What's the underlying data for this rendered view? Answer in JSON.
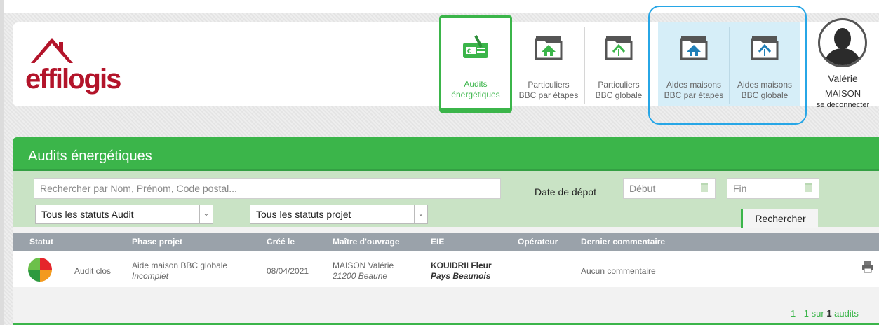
{
  "brand": {
    "name": "effilogis",
    "accent": "#3bb54a",
    "highlight": "#27a6e6"
  },
  "nav": {
    "items": [
      {
        "line1": "Audits",
        "line2": "énergétiques",
        "icon": "energy-audit-icon",
        "active": true
      },
      {
        "line1": "Particuliers",
        "line2": "BBC par étapes",
        "icon": "folder-house-icon"
      },
      {
        "line1": "Particuliers",
        "line2": "BBC globale",
        "icon": "folder-house-icon"
      },
      {
        "line1": "Aides maisons",
        "line2": "BBC par étapes",
        "icon": "folder-house-icon"
      },
      {
        "line1": "Aides maisons",
        "line2": "BBC globale",
        "icon": "folder-house-icon"
      }
    ]
  },
  "user": {
    "first": "Valérie",
    "last": "MAISON",
    "logout": "se déconnecter",
    "avatar_icon": "user-silhouette-icon"
  },
  "panel": {
    "title": "Audits énergétiques"
  },
  "filters": {
    "search_placeholder": "Rechercher par Nom, Prénom, Code postal...",
    "date_label": "Date de dépot",
    "start_placeholder": "Début",
    "end_placeholder": "Fin",
    "status_audit": "Tous les statuts Audit",
    "status_projet": "Tous les statuts projet",
    "search_button": "Rechercher"
  },
  "table": {
    "headers": [
      "Statut",
      "Phase projet",
      "Créé le",
      "Maître d'ouvrage",
      "EIE",
      "Opérateur",
      "Dernier commentaire"
    ],
    "rows": [
      {
        "status": "Audit clos",
        "phase": "Aide maison BBC globale",
        "phase_sub": "Incomplet",
        "created": "08/04/2021",
        "owner": "MAISON Valérie",
        "owner_sub": "21200 Beaune",
        "eie": "KOUIDRII Fleur",
        "eie_sub": "Pays Beaunois",
        "operator": "",
        "comment": "Aucun commentaire"
      }
    ]
  },
  "pagination": {
    "range": "1 - 1 sur",
    "total": "1",
    "unit": "audits"
  }
}
